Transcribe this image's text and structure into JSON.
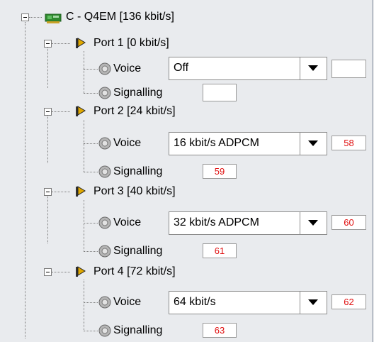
{
  "card": {
    "label": "C - Q4EM [136 kbit/s]",
    "icon": "board-card-icon"
  },
  "ports": [
    {
      "label": "Port 1 [0 kbit/s]",
      "voice_label": "Voice",
      "voice_value": "Off",
      "voice_id": "",
      "signalling_label": "Signalling",
      "signalling_id": ""
    },
    {
      "label": "Port 2 [24 kbit/s]",
      "voice_label": "Voice",
      "voice_value": "16 kbit/s ADPCM",
      "voice_id": "58",
      "signalling_label": "Signalling",
      "signalling_id": "59"
    },
    {
      "label": "Port 3 [40 kbit/s]",
      "voice_label": "Voice",
      "voice_value": "32 kbit/s ADPCM",
      "voice_id": "60",
      "signalling_label": "Signalling",
      "signalling_id": "61"
    },
    {
      "label": "Port 4 [72 kbit/s]",
      "voice_label": "Voice",
      "voice_value": "64 kbit/s",
      "voice_id": "62",
      "signalling_label": "Signalling",
      "signalling_id": "63"
    }
  ],
  "icons": {
    "port": "port-flag-icon",
    "channel": "channel-knob-icon",
    "dropdown": "chevron-down-icon"
  },
  "colors": {
    "background": "#e9ebee",
    "id_text": "#e01010"
  }
}
